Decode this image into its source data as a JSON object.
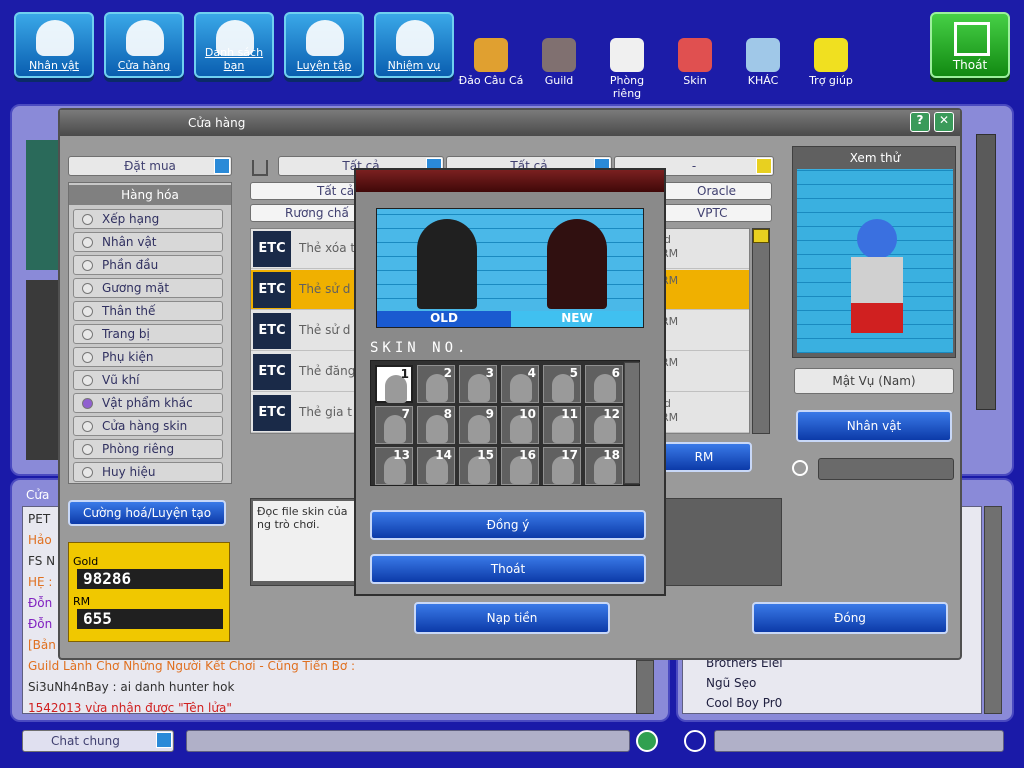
{
  "toolbar": {
    "buttons": [
      {
        "label": "Nhân vật",
        "icon": "person-icon"
      },
      {
        "label": "Cửa hàng",
        "icon": "cart-icon"
      },
      {
        "label": "Danh sách bạn",
        "icon": "friends-icon"
      },
      {
        "label": "Luyện tập",
        "icon": "dumbbell-icon"
      },
      {
        "label": "Nhiệm vụ",
        "icon": "quest-book-icon"
      }
    ],
    "small": [
      {
        "label": "Đảo Câu Cá",
        "icon": "palm-tree-icon"
      },
      {
        "label": "Guild",
        "icon": "castle-icon"
      },
      {
        "label": "Phòng riêng",
        "icon": "coffee-cup-icon"
      },
      {
        "label": "Skin",
        "icon": "spray-can-icon"
      },
      {
        "label": "KHÁC",
        "icon": "box-icon"
      },
      {
        "label": "Trợ giúp",
        "icon": "question-icon"
      }
    ],
    "exit_label": "Thoát"
  },
  "shop": {
    "title": "Cửa hàng",
    "mode": "Đặt mua",
    "categories_header": "Hàng hóa",
    "categories": [
      "Xếp hạng",
      "Nhân vật",
      "Phần đầu",
      "Gương mặt",
      "Thân thế",
      "Trang bị",
      "Phụ kiện",
      "Vũ khí",
      "Vật phẩm khác",
      "Cửa hàng skin",
      "Phòng riêng",
      "Huy hiệu"
    ],
    "selected_category": "Vật phẩm khác",
    "filter1": "Tất cả",
    "filter2": "Tất cả",
    "filter3": "-",
    "tab_row1_left": "Tất cả",
    "tab_row1_right": "Oracle",
    "tab_row2_left": "Rương chấ",
    "tab_row2_right": "VPTC",
    "items": [
      {
        "badge": "ETC",
        "name": "Thẻ xóa t",
        "price1": "ld",
        "price2": "RM"
      },
      {
        "badge": "ETC",
        "name": "Thẻ sử d",
        "price1": "RM",
        "price2": ""
      },
      {
        "badge": "ETC",
        "name": "Thẻ sử d",
        "price1": "RM",
        "price2": ""
      },
      {
        "badge": "ETC",
        "name": "Thẻ đăng",
        "price1": "RM",
        "price2": ""
      },
      {
        "badge": "ETC",
        "name": "Thẻ gia t",
        "price1": "ld",
        "price2": "RM"
      }
    ],
    "rm_button": "RM",
    "upgrade_button": "Cường hoá/Luyện tạo",
    "gold_label": "Gold",
    "gold_value": "98286",
    "rm_label": "RM",
    "rm_value": "655",
    "description": "Đọc file skin của\nng trò chơi.",
    "nap_tien": "Nạp tiền",
    "dong": "Đóng",
    "preview_title": "Xem thử",
    "preview_name": "Mật Vụ (Nam)",
    "preview_button": "Nhân vật"
  },
  "skin_dialog": {
    "old_label": "OLD",
    "new_label": "NEW",
    "skin_no_label": "SKIN NO.",
    "thumbs": [
      "1",
      "2",
      "3",
      "4",
      "5",
      "6",
      "7",
      "8",
      "9",
      "10",
      "11",
      "12",
      "13",
      "14",
      "15",
      "16",
      "17",
      "18"
    ],
    "ok_button": "Đồng ý",
    "cancel_button": "Thoát"
  },
  "chat": {
    "header": "Cửa",
    "lines": [
      {
        "text": "PET",
        "color": "#303030"
      },
      {
        "text": "Hảo",
        "color": "#e07020"
      },
      {
        "text": "FS N",
        "color": "#303030"
      },
      {
        "text": "HẸ :",
        "color": "#e07020"
      },
      {
        "text": "Đỗn",
        "color": "#8020c0"
      },
      {
        "text": "Đỗn",
        "color": "#8020c0"
      },
      {
        "text": "[Bản",
        "color": "#e07020"
      },
      {
        "text": "Guild Lành Chơ Những Người Kết Chơi - Cũng Tiến Bơ :",
        "color": "#e07020"
      },
      {
        "text": "Si3uNh4nBay : ai danh hunter hok",
        "color": "#303030"
      },
      {
        "text": "1542013 vừa nhận được \"Tên lửa\"",
        "color": "#d02020"
      }
    ],
    "channel": "Chat chung"
  },
  "users": [
    "Brothers Elel",
    "Ngũ Sẹo",
    "Cool Boy Pr0"
  ]
}
